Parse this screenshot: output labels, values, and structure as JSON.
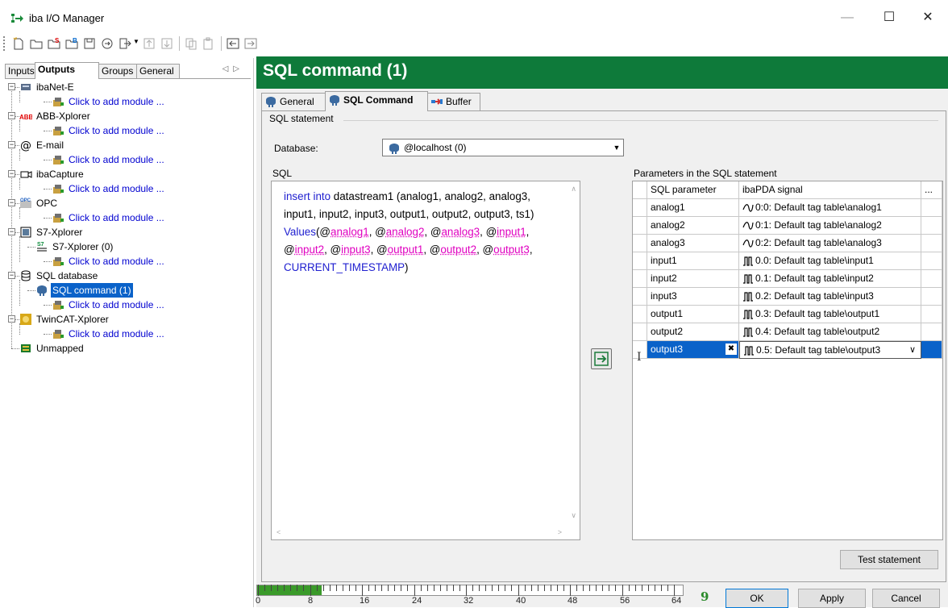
{
  "window": {
    "title": "iba I/O Manager"
  },
  "left_tabs": [
    "Inputs",
    "Outputs",
    "Groups",
    "General"
  ],
  "tree": [
    {
      "label": "ibaNet-E",
      "icon": "network-device-icon"
    },
    {
      "label": "Click to add module ...",
      "icon": "add-module-icon"
    },
    {
      "label": "ABB-Xplorer",
      "icon": "abb-logo-icon"
    },
    {
      "label": "Click to add module ...",
      "icon": "add-module-icon"
    },
    {
      "label": "E-mail",
      "icon": "at-sign-icon"
    },
    {
      "label": "Click to add module ...",
      "icon": "add-module-icon"
    },
    {
      "label": "ibaCapture",
      "icon": "camera-icon"
    },
    {
      "label": "Click to add module ...",
      "icon": "add-module-icon"
    },
    {
      "label": "OPC",
      "icon": "opc-icon"
    },
    {
      "label": "Click to add module ...",
      "icon": "add-module-icon"
    },
    {
      "label": "S7-Xplorer",
      "icon": "s7-icon"
    },
    {
      "label": "S7-Xplorer (0)",
      "icon": "s7-module-icon"
    },
    {
      "label": "Click to add module ...",
      "icon": "add-module-icon"
    },
    {
      "label": "SQL database",
      "icon": "database-icon"
    },
    {
      "label": "SQL command (1)",
      "icon": "sql-command-icon"
    },
    {
      "label": "Click to add module ...",
      "icon": "add-module-icon"
    },
    {
      "label": "TwinCAT-Xplorer",
      "icon": "twincat-icon"
    },
    {
      "label": "Click to add module ...",
      "icon": "add-module-icon"
    },
    {
      "label": "Unmapped",
      "icon": "unmapped-icon"
    }
  ],
  "header": {
    "title": "SQL command (1)"
  },
  "tabs": [
    "General",
    "SQL Command",
    "Buffer"
  ],
  "group_label": "SQL statement",
  "database": {
    "label": "Database:",
    "value": "@localhost (0)"
  },
  "sql": {
    "label": "SQL",
    "parts": [
      {
        "t": "insert into",
        "c": "kw"
      },
      {
        "t": " datastream1  (analog1, analog2, analog3, input1, input2, input3, output1, output2, output3, ts1) ",
        "c": ""
      },
      {
        "t": "Values",
        "c": "kw"
      },
      {
        "t": "(@",
        "c": ""
      },
      {
        "t": "analog1",
        "c": "par"
      },
      {
        "t": ", @",
        "c": ""
      },
      {
        "t": "analog2",
        "c": "par"
      },
      {
        "t": ", @",
        "c": ""
      },
      {
        "t": "analog3",
        "c": "par"
      },
      {
        "t": ", @",
        "c": ""
      },
      {
        "t": "input1",
        "c": "par"
      },
      {
        "t": ", @",
        "c": ""
      },
      {
        "t": "input2",
        "c": "par"
      },
      {
        "t": ", @",
        "c": ""
      },
      {
        "t": "input3",
        "c": "par"
      },
      {
        "t": ", @",
        "c": ""
      },
      {
        "t": "output1",
        "c": "par"
      },
      {
        "t": ", @",
        "c": ""
      },
      {
        "t": "output2",
        "c": "par"
      },
      {
        "t": ", @",
        "c": ""
      },
      {
        "t": "output3",
        "c": "par"
      },
      {
        "t": ", ",
        "c": ""
      },
      {
        "t": "CURRENT_TIMESTAMP",
        "c": "kw"
      },
      {
        "t": ")",
        "c": ""
      }
    ]
  },
  "params": {
    "label": "Parameters in the SQL statement",
    "col_param": "SQL parameter",
    "col_signal": "ibaPDA signal",
    "col_more": "...",
    "rows": [
      {
        "param": "analog1",
        "signal": "0:0: Default tag table\\analog1",
        "type": "analog"
      },
      {
        "param": "analog2",
        "signal": "0:1: Default tag table\\analog2",
        "type": "analog"
      },
      {
        "param": "analog3",
        "signal": "0:2: Default tag table\\analog3",
        "type": "analog"
      },
      {
        "param": "input1",
        "signal": "0.0: Default tag table\\input1",
        "type": "digital"
      },
      {
        "param": "input2",
        "signal": "0.1: Default tag table\\input2",
        "type": "digital"
      },
      {
        "param": "input3",
        "signal": "0.2: Default tag table\\input3",
        "type": "digital"
      },
      {
        "param": "output1",
        "signal": "0.3: Default tag table\\output1",
        "type": "digital"
      },
      {
        "param": "output2",
        "signal": "0.4: Default tag table\\output2",
        "type": "digital"
      },
      {
        "param": "output3",
        "signal": "0.5: Default tag table\\output3",
        "type": "digital",
        "selected": true
      }
    ]
  },
  "buttons": {
    "test": "Test statement",
    "ok": "OK",
    "apply": "Apply",
    "cancel": "Cancel"
  },
  "status": {
    "count": "9",
    "scale_labels": [
      "0",
      "8",
      "16",
      "24",
      "32",
      "40",
      "48",
      "56",
      "64"
    ],
    "progress_fraction": 0.15
  },
  "colors": {
    "header": "#0e7a3a",
    "selection": "#0a62c9",
    "keyword": "#2020d0",
    "param": "#e000c0"
  }
}
